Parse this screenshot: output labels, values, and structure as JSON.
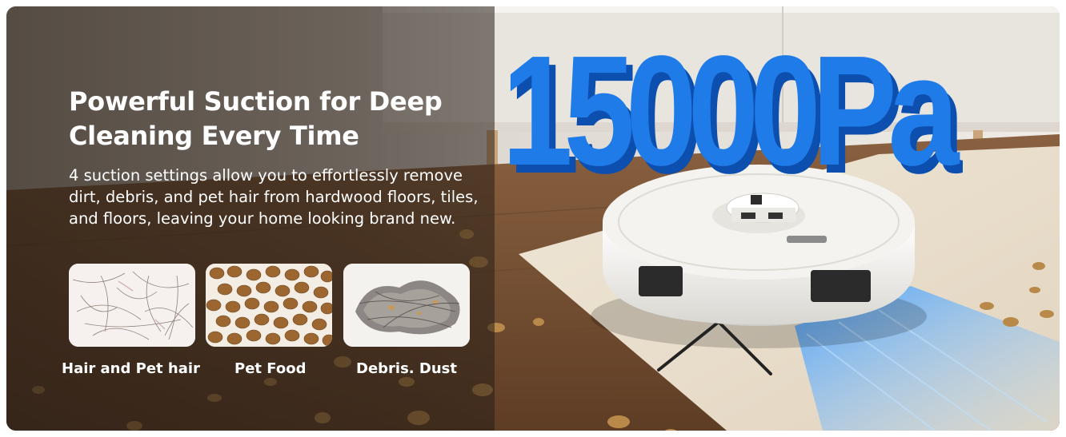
{
  "banner": {
    "headline_line1": "Powerful Suction for Deep",
    "headline_line2": "Cleaning Every Time",
    "description": "4 suction settings allow you to effortlessly remove dirt, debris, and pet hair from hardwood floors, tiles, and floors, leaving your home looking brand new.",
    "suction_value": "15000Pa",
    "categories": [
      {
        "label": "Hair and Pet hair",
        "icon": "pet-hair-photo"
      },
      {
        "label": "Pet Food",
        "icon": "pet-food-photo"
      },
      {
        "label": "Debris. Dust",
        "icon": "debris-dust-photo"
      }
    ]
  },
  "colors": {
    "headline_text": "#ffffff",
    "suction_blue": "#1e7be8",
    "robot_body": "#f1f0ec",
    "airflow": "#5ab0ff"
  }
}
